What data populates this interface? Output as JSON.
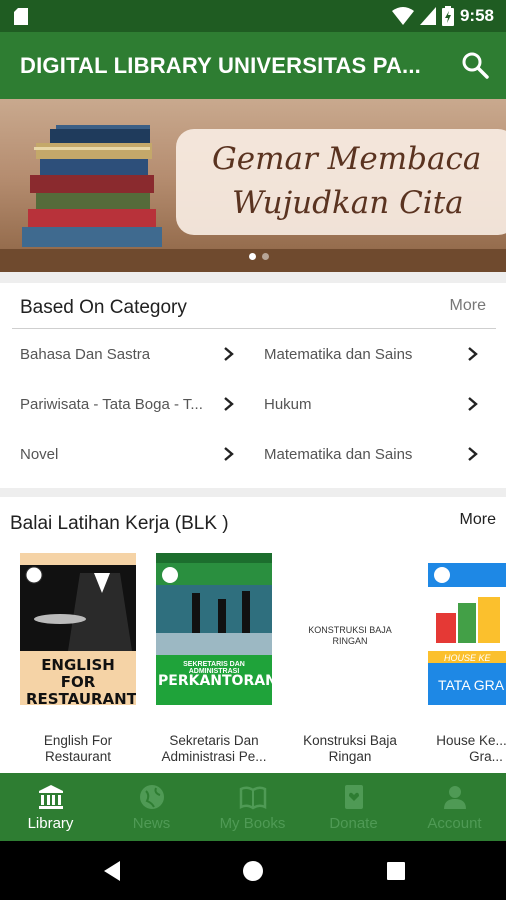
{
  "status_bar": {
    "time": "9:58"
  },
  "app_bar": {
    "title": "DIGITAL LIBRARY UNIVERSITAS PA..."
  },
  "banner": {
    "line1": "Gemar Membaca",
    "line2": "Wujudkan Cita",
    "active_slide": 1,
    "slide_count": 2
  },
  "category_section": {
    "title": "Based On Category",
    "more_label": "More",
    "items": [
      {
        "label": "Bahasa Dan Sastra"
      },
      {
        "label": "Matematika dan Sains"
      },
      {
        "label": "Pariwisata - Tata Boga - T..."
      },
      {
        "label": "Hukum"
      },
      {
        "label": "Novel"
      },
      {
        "label": "Matematika dan Sains"
      }
    ]
  },
  "blk_section": {
    "title": "Balai Latihan Kerja (BLK )",
    "more_label": "More",
    "books": [
      {
        "caption": "English For Restaurant",
        "cover_title": "ENGLISH FOR RESTAURANT"
      },
      {
        "caption": "Sekretaris Dan Administrasi Pe...",
        "cover_title": "PERKANTORAN",
        "cover_subtitle": "SEKRETARIS DAN ADMINISTRASI"
      },
      {
        "caption": "Konstruksi Baja Ringan",
        "cover_title": "KONSTRUKSI BAJA RINGAN"
      },
      {
        "caption": "House Ke... Tata Gra...",
        "cover_title": "HOUSE KE",
        "cover_subtitle": "TATA GRA"
      }
    ]
  },
  "bottom_nav": {
    "items": [
      {
        "label": "Library",
        "icon": "library-icon",
        "active": true
      },
      {
        "label": "News",
        "icon": "globe-icon",
        "active": false
      },
      {
        "label": "My Books",
        "icon": "book-open-icon",
        "active": false
      },
      {
        "label": "Donate",
        "icon": "donate-book-icon",
        "active": false
      },
      {
        "label": "Account",
        "icon": "person-icon",
        "active": false
      }
    ]
  },
  "colors": {
    "primary": "#2e7d32",
    "status_bar": "#1f5c22",
    "nav_inactive": "#4f9a55",
    "nav_active": "#ffffff"
  }
}
